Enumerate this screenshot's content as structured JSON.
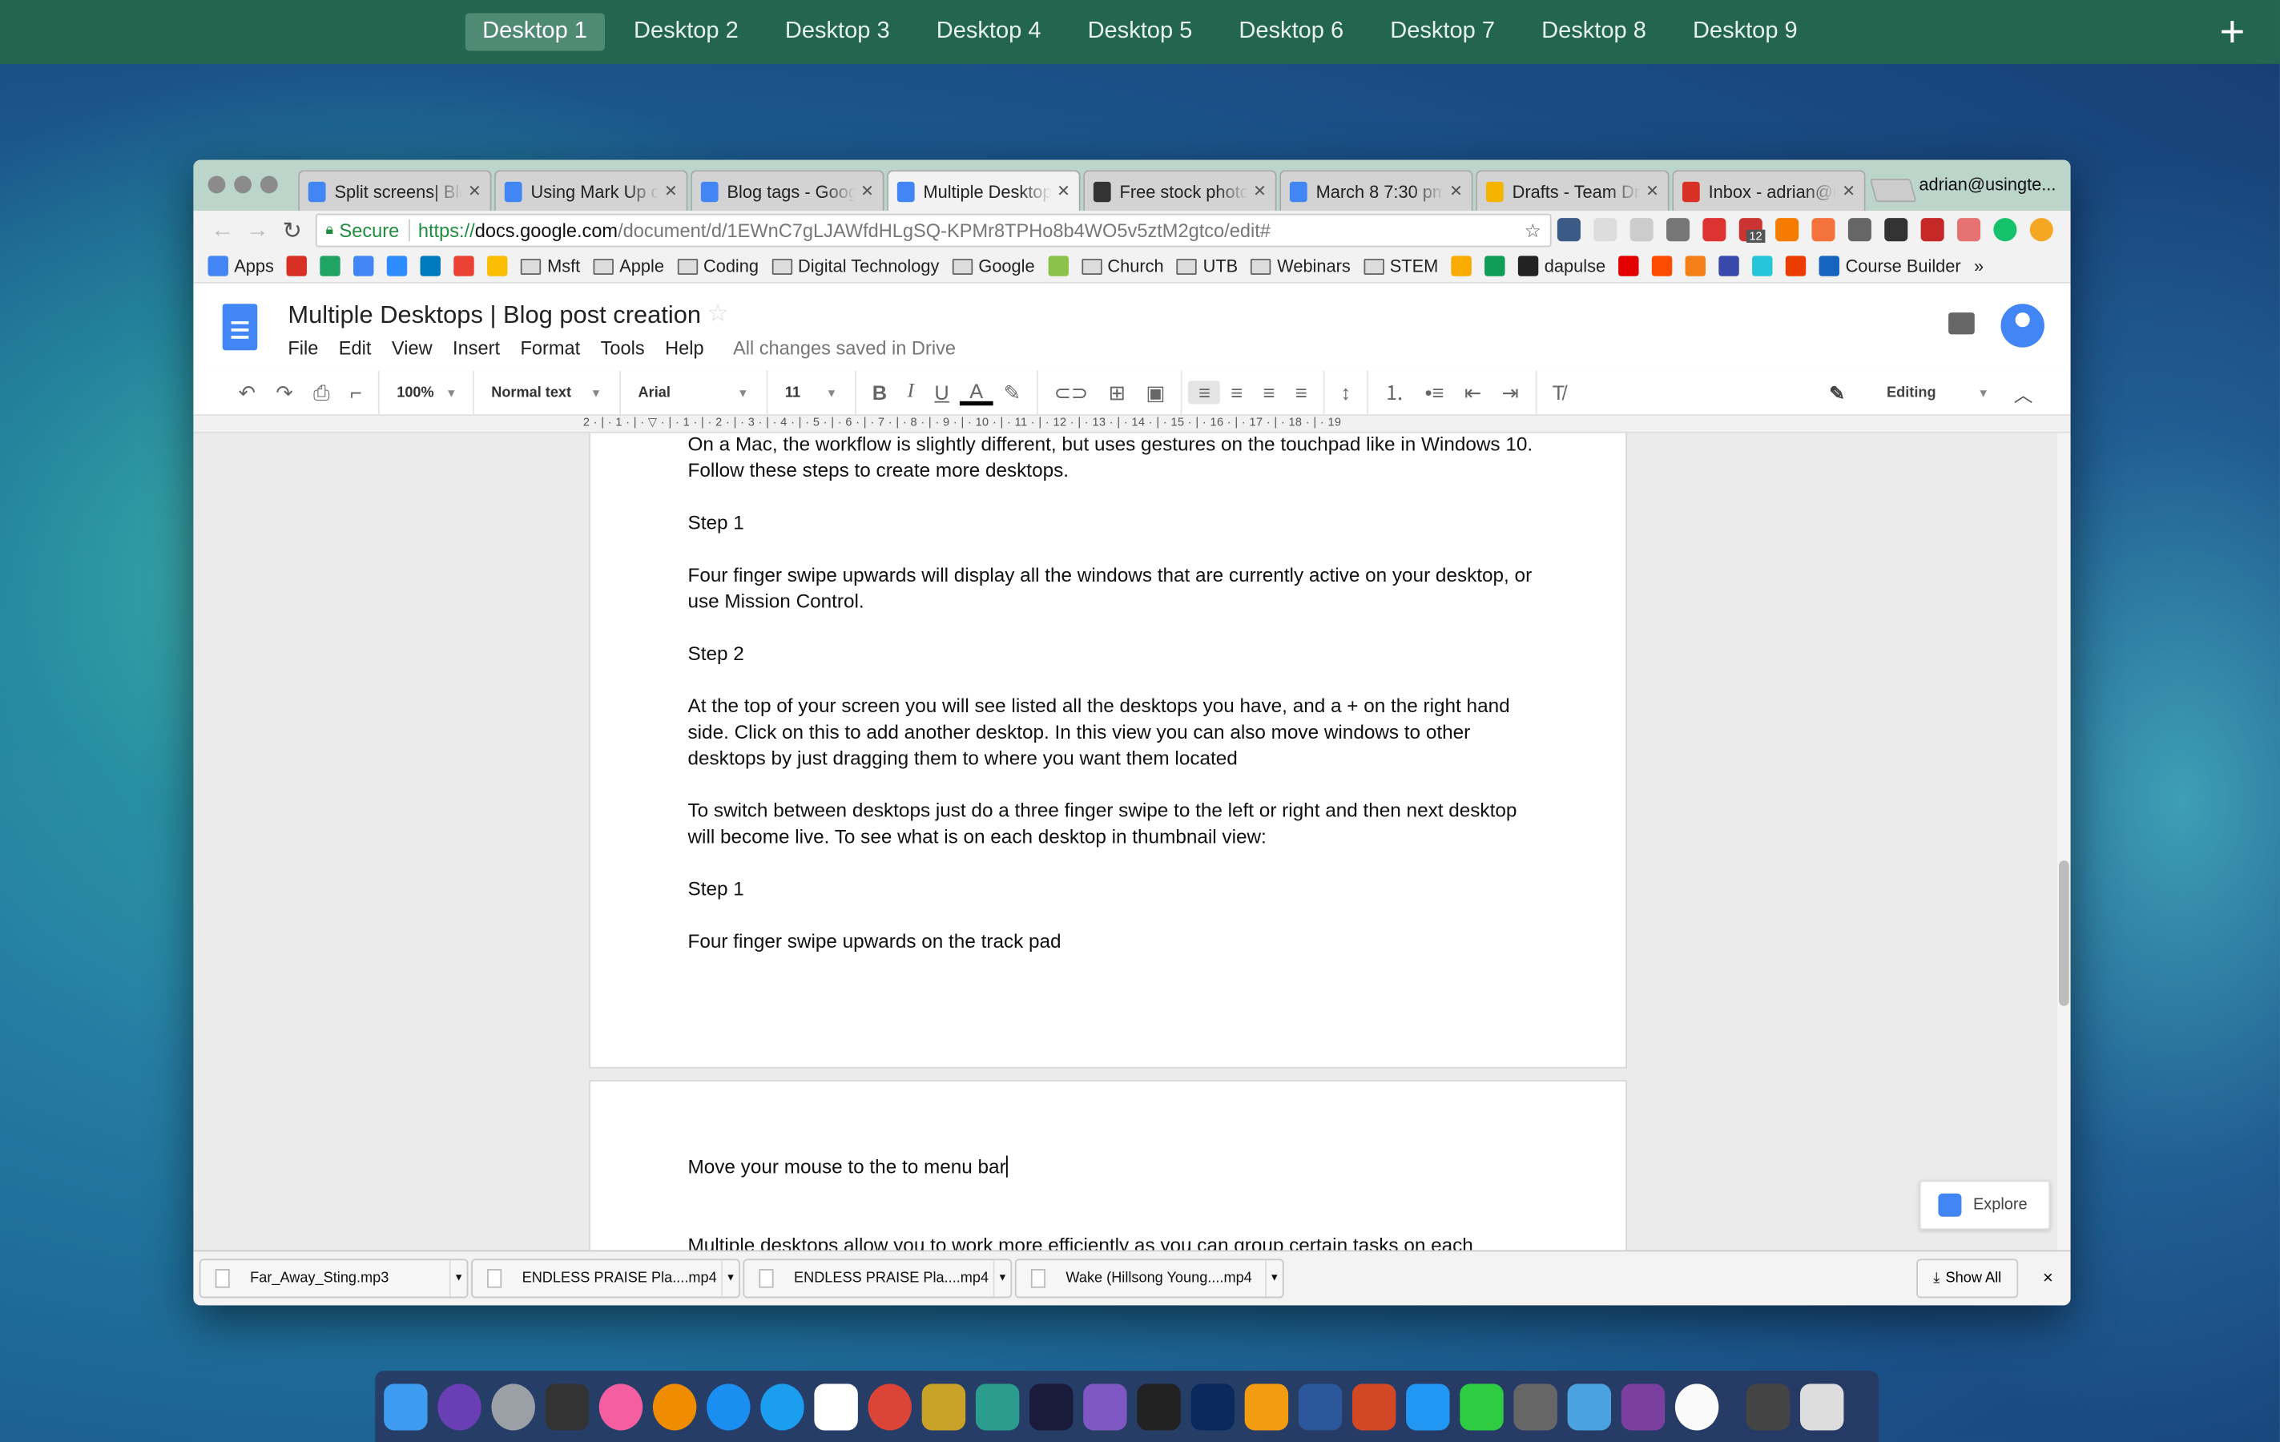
{
  "desktops": {
    "items": [
      "Desktop 1",
      "Desktop 2",
      "Desktop 3",
      "Desktop 4",
      "Desktop 5",
      "Desktop 6",
      "Desktop 7",
      "Desktop 8",
      "Desktop 9"
    ],
    "active": "Desktop 1",
    "add_icon": "plus-icon"
  },
  "browser": {
    "tabs": [
      {
        "title": "Split screens| Blog",
        "favicon": "docs",
        "color": "#4285f4"
      },
      {
        "title": "Using Mark Up on",
        "favicon": "docs",
        "color": "#4285f4"
      },
      {
        "title": "Blog tags - Google",
        "favicon": "docs",
        "color": "#4285f4"
      },
      {
        "title": "Multiple Desktops",
        "favicon": "docs",
        "color": "#4285f4",
        "active": true
      },
      {
        "title": "Free stock photos",
        "favicon": "camera",
        "color": "#333333"
      },
      {
        "title": "March 8 7:30 pm",
        "favicon": "docs",
        "color": "#4285f4"
      },
      {
        "title": "Drafts - Team Drive",
        "favicon": "drive",
        "color": "#f4b400"
      },
      {
        "title": "Inbox - adrian@u",
        "favicon": "gmail",
        "color": "#d93025"
      }
    ],
    "profile": "adrian@usingte...",
    "secure_label": "Secure",
    "url_scheme": "https://",
    "url_host": "docs.google.com",
    "url_path": "/document/d/1EWnC7gLJAWfdHLgSQ-KPMr8TPHo8b4WO5v5ztM2gtco/edit#",
    "extension_badge": "12",
    "bookmarks": [
      {
        "label": "Apps",
        "type": "apps"
      },
      {
        "label": "",
        "type": "gmail"
      },
      {
        "label": "",
        "type": "drive"
      },
      {
        "label": "",
        "type": "calendar"
      },
      {
        "label": "",
        "type": "zoom"
      },
      {
        "label": "",
        "type": "trello"
      },
      {
        "label": "",
        "type": "maps-pin"
      },
      {
        "label": "",
        "type": "keep"
      },
      {
        "label": "Msft",
        "type": "folder"
      },
      {
        "label": "Apple",
        "type": "folder"
      },
      {
        "label": "Coding",
        "type": "folder"
      },
      {
        "label": "Digital Technology",
        "type": "folder"
      },
      {
        "label": "Google",
        "type": "folder"
      },
      {
        "label": "",
        "type": "maps"
      },
      {
        "label": "Church",
        "type": "folder"
      },
      {
        "label": "UTB",
        "type": "folder"
      },
      {
        "label": "Webinars",
        "type": "folder"
      },
      {
        "label": "STEM",
        "type": "folder"
      },
      {
        "label": "",
        "type": "classroom"
      },
      {
        "label": "",
        "type": "hangouts"
      },
      {
        "label": "dapulse",
        "type": "dapulse"
      },
      {
        "label": "",
        "type": "qantas"
      },
      {
        "label": "",
        "type": "strava"
      },
      {
        "label": "",
        "type": "bookmark-y"
      },
      {
        "label": "",
        "type": "tool"
      },
      {
        "label": "",
        "type": "kahoot"
      },
      {
        "label": "",
        "type": "office"
      },
      {
        "label": "Course Builder",
        "type": "course-builder"
      }
    ],
    "more_bookmarks": "»"
  },
  "doc": {
    "title": "Multiple Desktops | Blog post creation",
    "menus": [
      "File",
      "Edit",
      "View",
      "Insert",
      "Format",
      "Tools",
      "Help"
    ],
    "save_status": "All changes saved in Drive",
    "toolbar": {
      "zoom": "100%",
      "style": "Normal text",
      "font": "Arial",
      "size": "11",
      "bold": "B",
      "italic": "I",
      "underline": "U",
      "text_color": "A",
      "mode": "Editing",
      "text_color_value": "#000000"
    },
    "ruler": "2 · | · 1 · | · ▽ · | · 1 · | · 2 · | · 3 · | · 4 · | · 5 · | · 6 · | · 7 · | · 8 · | · 9 · | · 10 · | · 11 · | · 12 · | · 13 · | · 14 · | · 15 · | · 16 · | · 17 · | · 18 · | · 19",
    "page1": [
      "On a Mac, the workflow is slightly different, but uses gestures on the touchpad like in Windows 10. Follow these steps to create more desktops.",
      "Step 1",
      "Four finger swipe upwards will display all the windows that are currently active on your desktop, or use Mission Control.",
      "Step 2",
      "At the top of your screen you will see listed all the desktops you have, and a + on the right hand side. Click on this to add another desktop. In this view you can also move windows to other desktops by just dragging them to where you want them located",
      "To switch between desktops just do a three finger swipe to the left or right and then next desktop will become live. To see what is on each desktop in thumbnail view:",
      "Step 1",
      "Four finger swipe upwards on the track pad"
    ],
    "page2": [
      "Move your mouse to the to menu bar",
      "Multiple desktops allow you to work more efficiently as you can group certain tasks on each"
    ],
    "explore": "Explore"
  },
  "downloads": {
    "items": [
      "Far_Away_Sting.mp3",
      "ENDLESS PRAISE  Pla....mp4",
      "ENDLESS PRAISE  Pla....mp4",
      "Wake (Hillsong Young....mp4"
    ],
    "show_all": "Show All",
    "close": "×"
  },
  "dock": {
    "apps": [
      "Finder",
      "Siri",
      "Launchpad",
      "Mission Control",
      "iTunes",
      "iBooks",
      "App Store",
      "Safari",
      "Google Apps",
      "Chrome",
      "Cocktail",
      "Slack",
      "QuickTime",
      "Final Cut Pro",
      "Claquette",
      "Photoshop",
      "Pages",
      "Word",
      "PowerPoint",
      "Messages",
      "FaceTime",
      "System Preferences",
      "Keynote",
      "OneNote",
      "Photos",
      "iMovie",
      "Trash"
    ]
  }
}
